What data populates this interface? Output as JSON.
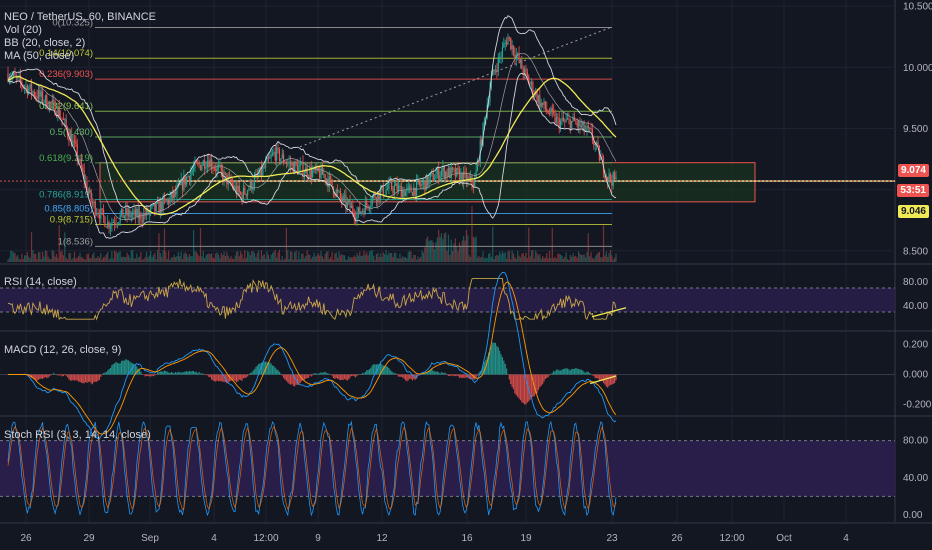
{
  "header": {
    "symbol_line": "NEO / TetherUS, 60, BINANCE",
    "indicators": [
      "Vol (20)",
      "BB (20, close, 2)",
      "MA (50, close)"
    ]
  },
  "price_labels": {
    "last": "9.074",
    "countdown": "53:51",
    "ma": "9.046"
  },
  "colors": {
    "background": "#131722",
    "grid": "#1f2330",
    "up": "#26a69a",
    "down": "#ef5350",
    "bb": "#d1d4dc",
    "ma": "#f0ea55",
    "rsi": "#c9a44a",
    "band_fill": "#2b1f4e",
    "zone_fill": "#1c3b1e",
    "last_price": "#ef5350",
    "ma_label": "#f0ea55"
  },
  "chart_data": [
    {
      "type": "candlestick",
      "pane": "price",
      "ylim": [
        8.4,
        10.55
      ],
      "y_ticks": [
        "10.500",
        "10.000",
        "9.500",
        "9.074",
        "8.500"
      ],
      "x_ticks": [
        "26",
        "29",
        "Sep",
        "4",
        "12:00",
        "9",
        "12",
        "16",
        "19",
        "23",
        "26",
        "12:00",
        "Oct",
        "4"
      ],
      "price_path": [
        {
          "t": 0,
          "p": 9.95
        },
        {
          "t": 2,
          "p": 9.85
        },
        {
          "t": 4,
          "p": 9.75
        },
        {
          "t": 6,
          "p": 9.65
        },
        {
          "t": 8,
          "p": 9.35
        },
        {
          "t": 10,
          "p": 8.9
        },
        {
          "t": 12,
          "p": 8.72
        },
        {
          "t": 14,
          "p": 8.8
        },
        {
          "t": 16,
          "p": 8.78
        },
        {
          "t": 18,
          "p": 8.85
        },
        {
          "t": 20,
          "p": 8.95
        },
        {
          "t": 22,
          "p": 9.15
        },
        {
          "t": 24,
          "p": 9.25
        },
        {
          "t": 26,
          "p": 9.1
        },
        {
          "t": 28,
          "p": 8.95
        },
        {
          "t": 30,
          "p": 9.1
        },
        {
          "t": 32,
          "p": 9.3
        },
        {
          "t": 34,
          "p": 9.2
        },
        {
          "t": 36,
          "p": 9.15
        },
        {
          "t": 38,
          "p": 9.12
        },
        {
          "t": 40,
          "p": 8.92
        },
        {
          "t": 42,
          "p": 8.8
        },
        {
          "t": 44,
          "p": 8.95
        },
        {
          "t": 46,
          "p": 9.02
        },
        {
          "t": 48,
          "p": 8.98
        },
        {
          "t": 50,
          "p": 9.05
        },
        {
          "t": 52,
          "p": 9.15
        },
        {
          "t": 54,
          "p": 9.12
        },
        {
          "t": 56,
          "p": 9.05
        },
        {
          "t": 58,
          "p": 9.9
        },
        {
          "t": 60,
          "p": 10.25
        },
        {
          "t": 62,
          "p": 9.95
        },
        {
          "t": 64,
          "p": 9.7
        },
        {
          "t": 66,
          "p": 9.55
        },
        {
          "t": 68,
          "p": 9.55
        },
        {
          "t": 70,
          "p": 9.45
        },
        {
          "t": 72,
          "p": 9.1
        },
        {
          "t": 73,
          "p": 9.07
        }
      ],
      "fibonacci": [
        {
          "label": "0(10.325)",
          "value": 10.325
        },
        {
          "label": "0.14(10.074)",
          "value": 10.074
        },
        {
          "label": "0.236(9.903)",
          "value": 9.903
        },
        {
          "label": "0.382(9.641)",
          "value": 9.641
        },
        {
          "label": "0.5(9.430)",
          "value": 9.43
        },
        {
          "label": "0.618(9.219)",
          "value": 9.219
        },
        {
          "label": "0.786(8.919)",
          "value": 8.919
        },
        {
          "label": "0.85(8.805)",
          "value": 8.805
        },
        {
          "label": "0.9(8.715)",
          "value": 8.715
        },
        {
          "label": "1(8.536)",
          "value": 8.536
        }
      ],
      "support_zone": [
        8.9,
        9.22
      ],
      "horizontal_level": 9.07
    },
    {
      "type": "line",
      "pane": "rsi",
      "legend": "RSI (14, close)",
      "ylim": [
        0,
        100
      ],
      "y_ticks": [
        "80.00",
        "40.00"
      ],
      "band": [
        30,
        70
      ]
    },
    {
      "type": "histogram",
      "pane": "macd",
      "legend": "MACD (12, 26, close, 9)",
      "ylim": [
        -0.25,
        0.25
      ],
      "y_ticks": [
        "0.200",
        "0.000",
        "-0.200"
      ]
    },
    {
      "type": "line",
      "pane": "stochrsi",
      "legend": "Stoch RSI (3, 3, 14, 14, close)",
      "ylim": [
        0,
        100
      ],
      "y_ticks": [
        "80.00",
        "40.00",
        "0.00"
      ],
      "band": [
        20,
        80
      ]
    }
  ]
}
